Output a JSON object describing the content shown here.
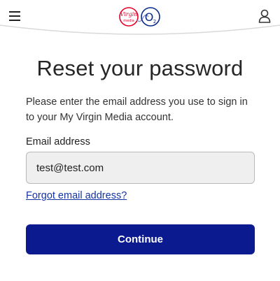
{
  "header": {
    "menu_icon": "hamburger-menu-icon",
    "account_icon": "user-account-icon",
    "logo": {
      "name": "virgin-media-o2-logo",
      "virgin_text": "Virgin",
      "media_text": "media",
      "o2_text": "O",
      "o2_sub": "2"
    }
  },
  "main": {
    "title": "Reset your password",
    "intro": "Please enter the email address you use to sign in to your My Virgin Media account.",
    "email_label": "Email address",
    "email_value": "test@test.com",
    "forgot_link": "Forgot email address?",
    "continue_label": "Continue"
  },
  "colors": {
    "primary_button": "#0b1a8f",
    "link": "#1433a4",
    "input_background": "#efefef",
    "virgin_red": "#e1002a",
    "o2_blue": "#0a2a8c"
  }
}
